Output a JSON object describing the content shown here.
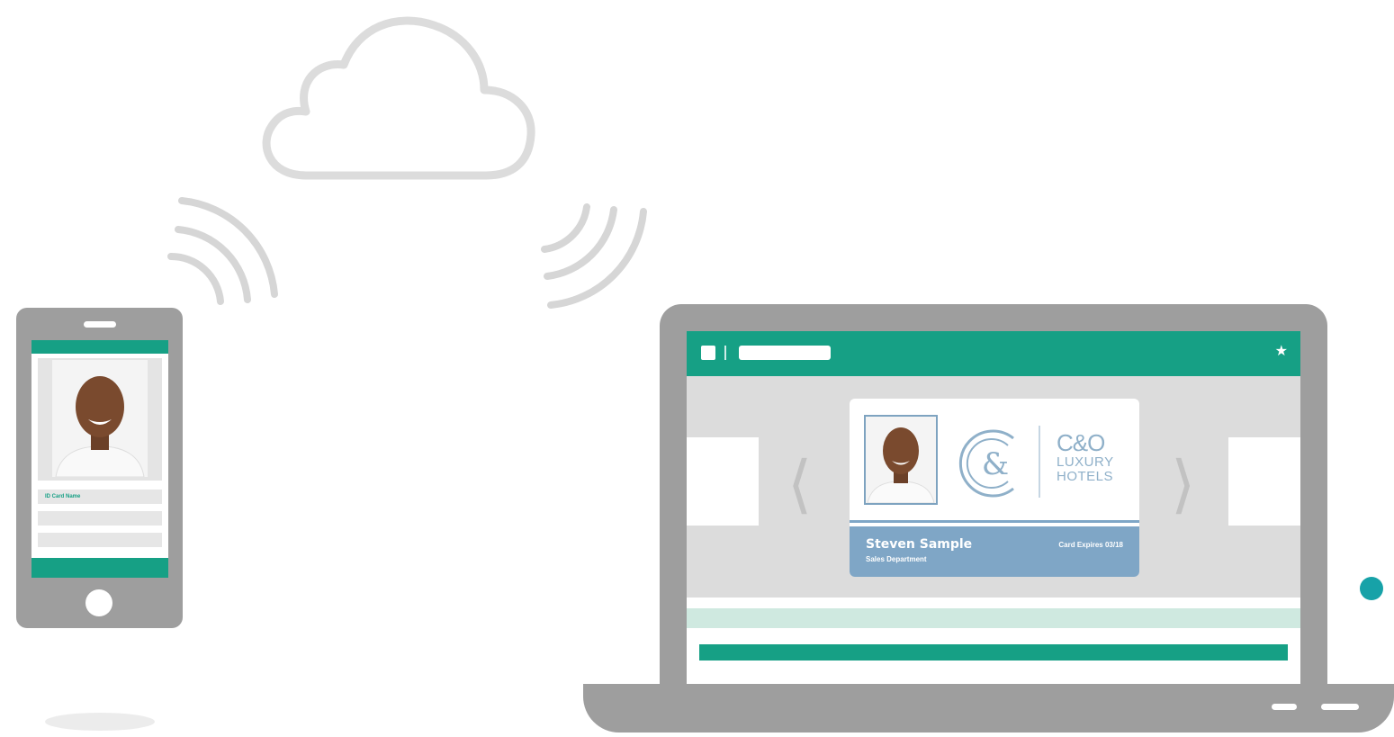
{
  "colors": {
    "accent": "#16a085",
    "accent_light": "#cfe9e0",
    "device_gray": "#9e9e9e",
    "cloud_gray": "#dcdcdc",
    "card_blue": "#7fa6c6",
    "dot_teal": "#17a2a8"
  },
  "icons": {
    "cloud": "cloud-icon",
    "signal_left": "signal-waves-icon",
    "signal_right": "signal-waves-icon",
    "star": "star-icon",
    "prev": "chevron-left-icon",
    "next": "chevron-right-icon"
  },
  "phone": {
    "name_row_label": "ID Card Name"
  },
  "app": {
    "star_glyph": "★",
    "prev_glyph": "⟨",
    "next_glyph": "⟩"
  },
  "card": {
    "brand_line1": "C&O",
    "brand_line2": "LUXURY",
    "brand_line3": "HOTELS",
    "holder_name": "Steven Sample",
    "department": "Sales Department",
    "expiry": "Card Expires 03/18"
  }
}
